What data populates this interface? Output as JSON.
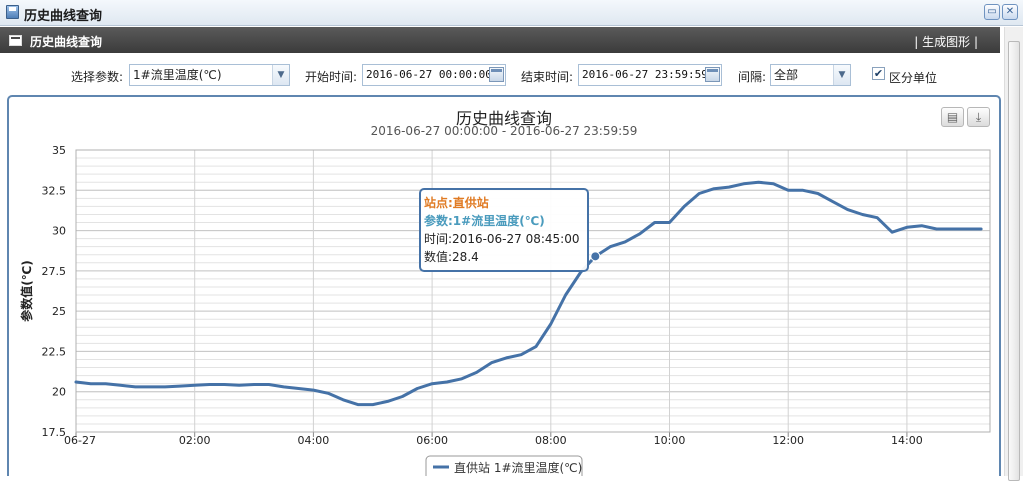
{
  "window": {
    "title": "历史曲线查询"
  },
  "panel": {
    "title": "历史曲线查询",
    "generate_action": "| 生成图形 |"
  },
  "filters": {
    "param_label": "选择参数:",
    "param_value": "1#流里温度(℃)",
    "start_label": "开始时间:",
    "start_value": "2016-06-27 00:00:00",
    "end_label": "结束时间:",
    "end_value": "2016-06-27 23:59:59",
    "interval_label": "间隔:",
    "interval_value": "全部",
    "distinguish_label": "区分单位",
    "distinguish_checked": true
  },
  "chart_data": {
    "type": "line",
    "title": "历史曲线查询",
    "subtitle": "2016-06-27 00:00:00 - 2016-06-27 23:59:59",
    "ylabel": "参数值(℃)",
    "xlabel": "",
    "ylim": [
      17.5,
      35
    ],
    "yticks": [
      "17.5",
      "20",
      "22.5",
      "25",
      "27.5",
      "30",
      "32.5",
      "35"
    ],
    "xlim": [
      0,
      15.4
    ],
    "xticks": [
      {
        "v": 0,
        "label": "06-27"
      },
      {
        "v": 2,
        "label": "02:00"
      },
      {
        "v": 4,
        "label": "04:00"
      },
      {
        "v": 6,
        "label": "06:00"
      },
      {
        "v": 8,
        "label": "08:00"
      },
      {
        "v": 10,
        "label": "10:00"
      },
      {
        "v": 12,
        "label": "12:00"
      },
      {
        "v": 14,
        "label": "14:00"
      }
    ],
    "color": "#4572a7",
    "series": [
      {
        "name": "直供站 1#流里温度(℃)",
        "x": [
          0,
          0.25,
          0.5,
          0.75,
          1.0,
          1.25,
          1.5,
          1.75,
          2.0,
          2.25,
          2.5,
          2.75,
          3.0,
          3.25,
          3.5,
          3.75,
          4.0,
          4.25,
          4.5,
          4.75,
          5.0,
          5.25,
          5.5,
          5.75,
          6.0,
          6.25,
          6.5,
          6.75,
          7.0,
          7.25,
          7.5,
          7.75,
          8.0,
          8.25,
          8.5,
          8.75,
          9.0,
          9.25,
          9.5,
          9.75,
          10.0,
          10.25,
          10.5,
          10.75,
          11.0,
          11.25,
          11.5,
          11.75,
          12.0,
          12.25,
          12.5,
          12.75,
          13.0,
          13.25,
          13.5,
          13.75,
          14.0,
          14.25,
          14.5,
          14.75,
          15.0,
          15.25
        ],
        "y": [
          20.6,
          20.5,
          20.5,
          20.4,
          20.3,
          20.3,
          20.3,
          20.35,
          20.4,
          20.45,
          20.45,
          20.4,
          20.45,
          20.45,
          20.3,
          20.2,
          20.1,
          19.9,
          19.5,
          19.2,
          19.2,
          19.4,
          19.7,
          20.2,
          20.5,
          20.6,
          20.8,
          21.2,
          21.8,
          22.1,
          22.3,
          22.8,
          24.2,
          26.0,
          27.4,
          28.4,
          29.0,
          29.3,
          29.8,
          30.5,
          30.5,
          31.5,
          32.3,
          32.6,
          32.7,
          32.9,
          33.0,
          32.9,
          32.5,
          32.5,
          32.3,
          31.8,
          31.3,
          31.0,
          30.8,
          29.9,
          30.2,
          30.3,
          30.1,
          30.1,
          30.1,
          30.1
        ]
      }
    ],
    "highlight": {
      "x": 8.75,
      "y": 28.4
    },
    "tooltip": {
      "station": "站点:直供站",
      "param": "参数:1#流里温度(℃)",
      "time": "时间:2016-06-27 08:45:00",
      "value": "数值:28.4"
    },
    "legend": {
      "label": "直供站 1#流里温度(℃)",
      "position": "bottom-center"
    },
    "grid": true
  }
}
